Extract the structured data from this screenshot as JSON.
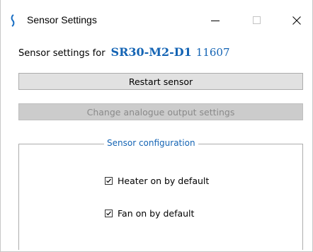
{
  "window": {
    "title": "Sensor Settings"
  },
  "header": {
    "prefix": "Sensor settings for",
    "model": "SR30-M2-D1",
    "serial": "11607",
    "accent_color": "#1464b4"
  },
  "buttons": {
    "restart_label": "Restart sensor",
    "analogue_label": "Change analogue output settings",
    "analogue_enabled": false
  },
  "configuration": {
    "legend": "Sensor configuration",
    "heater": {
      "label": "Heater on by default",
      "checked": true
    },
    "fan": {
      "label": "Fan on by default",
      "checked": true
    }
  },
  "icons": {
    "app": "sensor-app-icon",
    "minimize": "minimize-icon",
    "maximize": "maximize-icon",
    "close": "close-icon",
    "checkmark": "checkmark-icon"
  }
}
